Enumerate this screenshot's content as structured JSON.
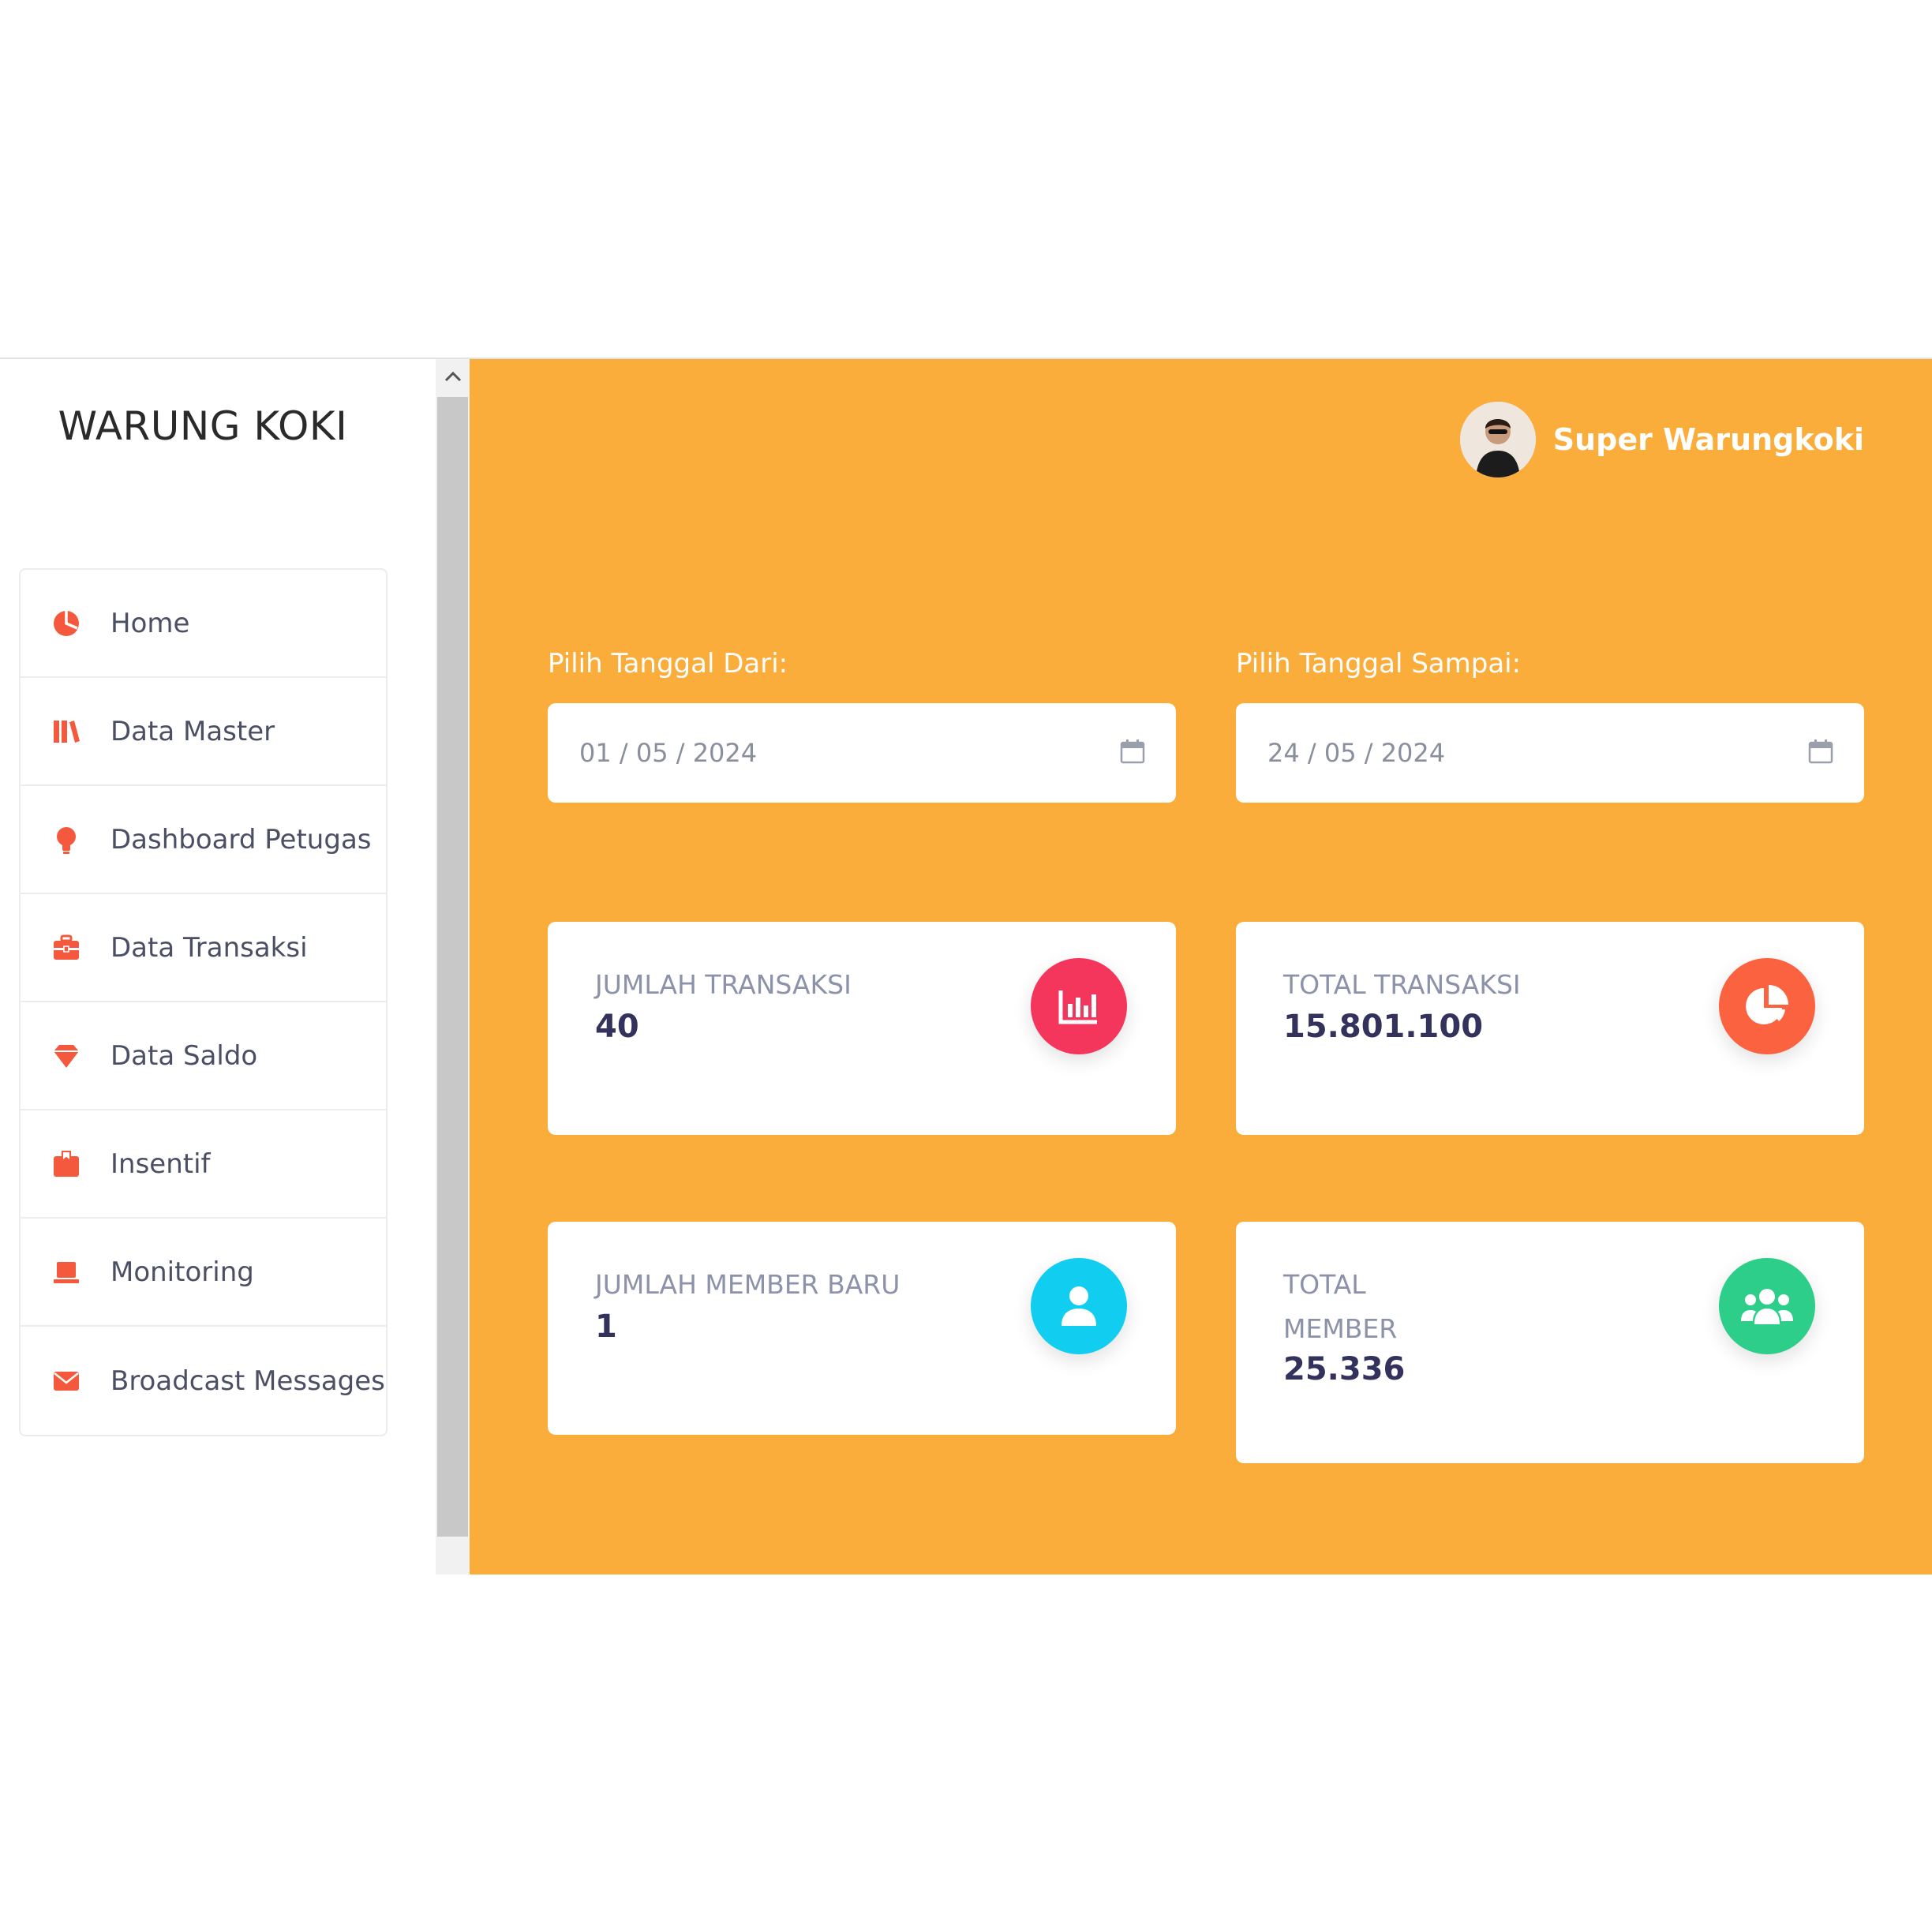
{
  "brand": "WARUNG KOKI",
  "sidebar": {
    "items": [
      {
        "label": "Home",
        "icon": "pie-chart-icon"
      },
      {
        "label": "Data Master",
        "icon": "books-icon"
      },
      {
        "label": "Dashboard Petugas",
        "icon": "bulb-icon"
      },
      {
        "label": "Data Transaksi",
        "icon": "briefcase-icon"
      },
      {
        "label": "Data Saldo",
        "icon": "diamond-icon"
      },
      {
        "label": "Insentif",
        "icon": "box-icon"
      },
      {
        "label": "Monitoring",
        "icon": "laptop-icon"
      },
      {
        "label": "Broadcast Messages",
        "icon": "envelope-icon"
      }
    ],
    "icon_color": "#f5593d"
  },
  "header": {
    "user_name": "Super Warungkoki"
  },
  "filters": {
    "from_label": "Pilih Tanggal Dari:",
    "from_value": "01 / 05 / 2024",
    "to_label": "Pilih Tanggal Sampai:",
    "to_value": "24 / 05 / 2024"
  },
  "stats": {
    "jumlah_transaksi": {
      "title": "JUMLAH TRANSAKSI",
      "value": "40",
      "color": "#f5365c",
      "icon": "bar-chart-icon"
    },
    "total_transaksi": {
      "title": "TOTAL TRANSAKSI",
      "value": "15.801.100",
      "color": "#fb6340",
      "icon": "pie-chart-icon"
    },
    "jumlah_member_baru": {
      "title": "JUMLAH MEMBER BARU",
      "value": "1",
      "color": "#11cdef",
      "icon": "user-icon"
    },
    "total_member": {
      "title": "TOTAL MEMBER",
      "value": "25.336",
      "color": "#2dce89",
      "icon": "users-icon"
    }
  },
  "colors": {
    "main_background": "#fbad3c",
    "card_title": "#8b92a9",
    "card_value": "#32325d"
  }
}
